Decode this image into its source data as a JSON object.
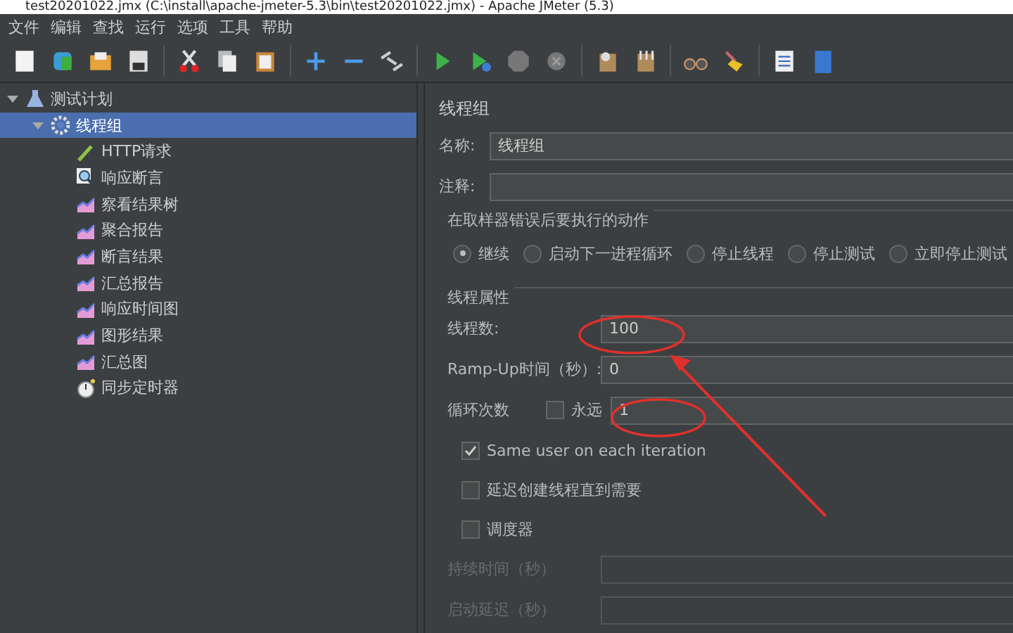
{
  "window": {
    "title": "test20201022.jmx (C:\\install\\apache-jmeter-5.3\\bin\\test20201022.jmx) - Apache JMeter (5.3)"
  },
  "menu": [
    "文件",
    "编辑",
    "查找",
    "运行",
    "选项",
    "工具",
    "帮助"
  ],
  "tree": [
    {
      "label": "测试计划",
      "kind": "plan",
      "expanded": true,
      "selected": false,
      "children": [
        {
          "label": "线程组",
          "kind": "threads",
          "expanded": true,
          "selected": true,
          "children": [
            {
              "label": "HTTP请求",
              "kind": "sampler",
              "selected": false
            },
            {
              "label": "响应断言",
              "kind": "assertion",
              "selected": false
            },
            {
              "label": "察看结果树",
              "kind": "listener",
              "selected": false
            },
            {
              "label": "聚合报告",
              "kind": "listener",
              "selected": false
            },
            {
              "label": "断言结果",
              "kind": "listener",
              "selected": false
            },
            {
              "label": "汇总报告",
              "kind": "listener",
              "selected": false
            },
            {
              "label": "响应时间图",
              "kind": "listener",
              "selected": false
            },
            {
              "label": "图形结果",
              "kind": "listener",
              "selected": false
            },
            {
              "label": "汇总图",
              "kind": "listener",
              "selected": false
            },
            {
              "label": "同步定时器",
              "kind": "timer",
              "selected": false
            }
          ]
        }
      ]
    }
  ],
  "panel": {
    "title": "线程组",
    "name": {
      "label": "名称:",
      "value": "线程组"
    },
    "comment": {
      "label": "注释:"
    },
    "error_action": {
      "title": "在取样器错误后要执行的动作",
      "options": [
        {
          "label": "继续",
          "selected": true
        },
        {
          "label": "启动下一进程循环",
          "selected": false
        },
        {
          "label": "停止线程",
          "selected": false
        },
        {
          "label": "停止测试",
          "selected": false
        },
        {
          "label": "立即停止测试",
          "selected": false
        }
      ]
    },
    "thread_props": {
      "title": "线程属性",
      "threads": {
        "label": "线程数:",
        "value": "100"
      },
      "ramp_up": {
        "label": "Ramp-Up时间（秒）:",
        "value": "0"
      },
      "loops": {
        "label": "循环次数",
        "forever_label": "永远",
        "forever_checked": false,
        "value": "1"
      },
      "checks": [
        {
          "label": "Same user on each iteration",
          "checked": true
        },
        {
          "label": "延迟创建线程直到需要",
          "checked": false
        },
        {
          "label": "调度器",
          "checked": false
        }
      ],
      "duration": {
        "label": "持续时间（秒）",
        "disabled": true
      },
      "startup_delay": {
        "label": "启动延迟（秒）",
        "disabled": true
      }
    }
  }
}
